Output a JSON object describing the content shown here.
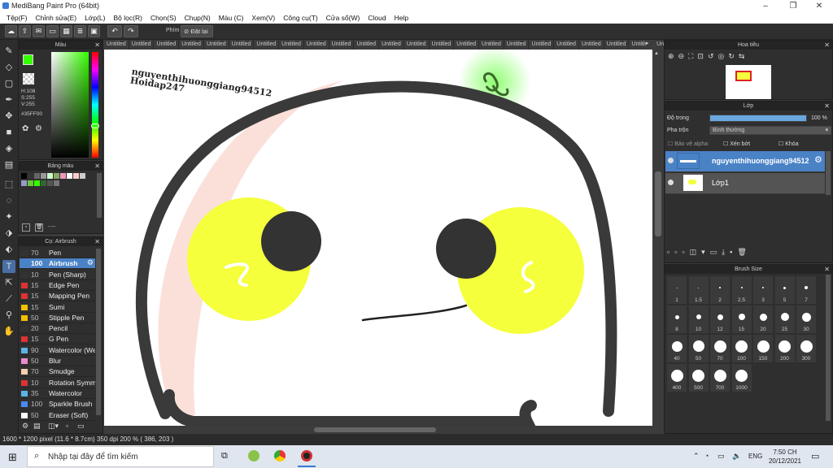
{
  "window": {
    "title": "MediBang Paint Pro (64bit)",
    "min": "–",
    "max": "❐",
    "close": "✕"
  },
  "menu": [
    "Tệp(F)",
    "Chỉnh sửa(E)",
    "Lớp(L)",
    "Bộ lọc(R)",
    "Chọn(S)",
    "Chụp(N)",
    "Màu (C)",
    "Xem(V)",
    "Công cụ(T)",
    "Cửa sổ(W)",
    "Cloud",
    "Help"
  ],
  "toolbar": {
    "key_label": "Phím",
    "reset_label": "Đặt lại"
  },
  "color_panel": {
    "title": "Màu",
    "h": "H:108",
    "s": "S:255",
    "v": "V:255",
    "hex": "#35FF00",
    "fg_color": "#35FF00"
  },
  "palette_panel": {
    "title": "Bảng màu",
    "dash": "----"
  },
  "brush_panel": {
    "title": "Cọ: Airbrush",
    "brushes": [
      {
        "size": "70",
        "name": "Pen",
        "color": "#333333"
      },
      {
        "size": "100",
        "name": "Airbrush",
        "color": "#4a82c6"
      },
      {
        "size": "10",
        "name": "Pen (Sharp)",
        "color": "#333333"
      },
      {
        "size": "15",
        "name": "Edge Pen",
        "color": "#d33"
      },
      {
        "size": "15",
        "name": "Mapping Pen",
        "color": "#d33"
      },
      {
        "size": "15",
        "name": "Sumi",
        "color": "#f0c000"
      },
      {
        "size": "50",
        "name": "Stipple Pen",
        "color": "#f0c000"
      },
      {
        "size": "20",
        "name": "Pencil",
        "color": "#333333"
      },
      {
        "size": "15",
        "name": "G Pen",
        "color": "#d33"
      },
      {
        "size": "90",
        "name": "Watercolor (Wet)",
        "color": "#5ab4e8"
      },
      {
        "size": "50",
        "name": "Blur",
        "color": "#e88ad0"
      },
      {
        "size": "70",
        "name": "Smudge",
        "color": "#f0d0b0"
      },
      {
        "size": "10",
        "name": "Rotation Symmetry",
        "color": "#d33"
      },
      {
        "size": "35",
        "name": "Watercolor",
        "color": "#5ab4e8"
      },
      {
        "size": "100",
        "name": "Sparkle Brush",
        "color": "#4a8af0"
      },
      {
        "size": "50",
        "name": "Eraser (Soft)",
        "color": "#ffffff"
      }
    ]
  },
  "tabs": [
    "Untitled",
    "Untitled",
    "Untitled",
    "Untitled",
    "Untitled",
    "Untitled",
    "Untitled",
    "Untitled",
    "Untitled",
    "Untitled",
    "Untitled",
    "Untitled",
    "Untitled",
    "Untitled",
    "Untitled",
    "Untitled",
    "Untitled",
    "Untitled",
    "Untitled",
    "Untitled",
    "Untitled",
    "Untitled",
    "Untitled",
    "Untitled"
  ],
  "canvas": {
    "watermark_line1": "nguyenthihuonggiang94512",
    "watermark_line2": "Hoidap247"
  },
  "navigator": {
    "title": "Hoa tiêu"
  },
  "layer_panel": {
    "title": "Lớp",
    "opacity_label": "Độ trong",
    "opacity_value": "100 %",
    "blend_label": "Pha trộn",
    "blend_value": "Bình thường",
    "protect_alpha": "Bảo vệ alpha",
    "clipping": "Xén bớt",
    "lock": "Khóa",
    "layers": [
      {
        "name": "nguyenthihuonggiang94512",
        "selected": true
      },
      {
        "name": "Lớp1",
        "selected": false
      }
    ]
  },
  "brush_size_panel": {
    "title": "Brush Size",
    "sizes": [
      "1",
      "1.5",
      "2",
      "2.5",
      "3",
      "5",
      "7",
      "8",
      "10",
      "12",
      "15",
      "20",
      "25",
      "30",
      "40",
      "50",
      "70",
      "100",
      "150",
      "200",
      "300",
      "400",
      "500",
      "700",
      "1000"
    ]
  },
  "status": {
    "dimensions": "1600 * 1200 pixel",
    "physical": "(11.6 * 8.7cm)",
    "dpi": "350 dpi",
    "zoom": "200 %",
    "coords": "( 386, 203 )"
  },
  "taskbar": {
    "search_placeholder": "Nhập tại đây để tìm kiếm",
    "lang": "ENG",
    "time": "7:50 CH",
    "date": "20/12/2021"
  }
}
